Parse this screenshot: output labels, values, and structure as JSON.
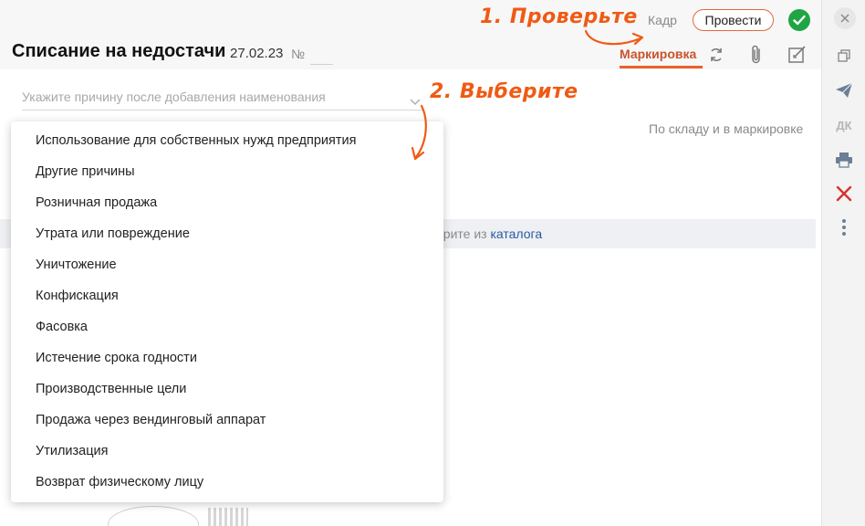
{
  "header": {
    "title": "Списание на недостачи",
    "date": "27.02.23",
    "number_label": "№",
    "kadr": "Кадр",
    "post_button": "Провести",
    "tab_marking": "Маркировка"
  },
  "form": {
    "reason_placeholder": "Укажите причину после добавления наименования",
    "by_stock": "По складу и в маркировке",
    "catalog_prefix": "ерите из",
    "catalog_link": "каталога"
  },
  "dropdown": {
    "items": [
      "Использование для собственных нужд предприятия",
      "Другие причины",
      "Розничная продажа",
      "Утрата или повреждение",
      "Уничтожение",
      "Конфискация",
      "Фасовка",
      "Истечение срока годности",
      "Производственные цели",
      "Продажа через вендинговый аппарат",
      "Утилизация",
      "Возврат физическому лицу"
    ]
  },
  "annotations": {
    "step1": "1. Проверьте",
    "step2": "2. Выберите"
  },
  "toolbar": {
    "dk_label": "ДК",
    "icons": [
      "close-icon",
      "copy-icon",
      "send-icon",
      "dk-icon",
      "print-icon",
      "delete-icon",
      "more-icon"
    ]
  },
  "colors": {
    "accent": "#e8632b",
    "success": "#1fa544",
    "link": "#2a5aa3",
    "danger": "#d9302b"
  }
}
